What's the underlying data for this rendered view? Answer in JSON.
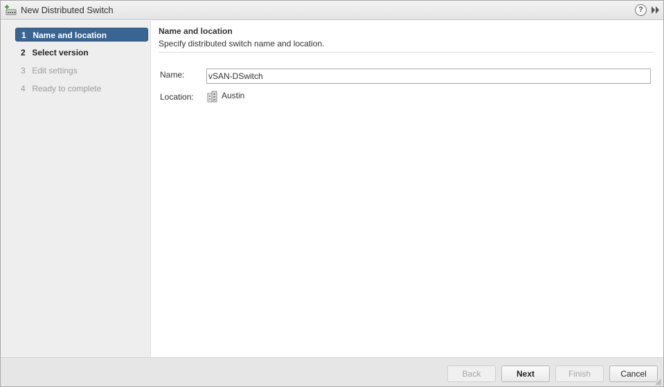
{
  "window": {
    "title": "New Distributed Switch",
    "icons": {
      "title": "distributed-switch-icon",
      "help": "help-icon",
      "expand": "double-chevron-right-icon"
    },
    "help_glyph": "?"
  },
  "steps": [
    {
      "num": "1",
      "label": "Name and location",
      "state": "active"
    },
    {
      "num": "2",
      "label": "Select version",
      "state": "enabled"
    },
    {
      "num": "3",
      "label": "Edit settings",
      "state": "disabled"
    },
    {
      "num": "4",
      "label": "Ready to complete",
      "state": "disabled"
    }
  ],
  "page": {
    "title": "Name and location",
    "description": "Specify distributed switch name and location.",
    "name_label": "Name:",
    "name_value": "vSAN-DSwitch",
    "location_label": "Location:",
    "location_value": "Austin",
    "location_icon": "datacenter-icon"
  },
  "footer": {
    "back": "Back",
    "next": "Next",
    "finish": "Finish",
    "cancel": "Cancel"
  },
  "colors": {
    "active_step_bg": "#3a6592",
    "sidebar_bg": "#eeeeee",
    "footer_bg": "#e6e6e6"
  }
}
